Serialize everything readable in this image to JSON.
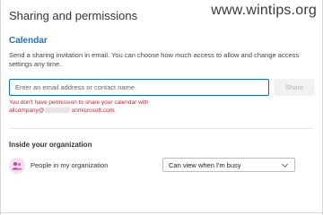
{
  "dialog": {
    "title": "Sharing and permissions",
    "watermark": "www.wintips.org"
  },
  "calendar": {
    "heading": "Calendar",
    "description": "Send a sharing invitation in email. You can choose how much access to allow and change access settings any time.",
    "email_placeholder": "Enter an email address or contact name",
    "email_value": "",
    "share_label": "Share",
    "error_line1": "You don't have permission to share your calendar with",
    "error_prefix": "allcompany@",
    "error_suffix": "onmicrosoft.com."
  },
  "organization": {
    "heading": "Inside your organization",
    "people_label": "People in my organization",
    "permission_value": "Can view when I'm busy",
    "icon": "people-group-icon"
  },
  "colors": {
    "accent": "#1a73c8",
    "error": "#c4262e",
    "input_border": "#0f6cbd",
    "avatar_bg": "#f6dff0"
  }
}
